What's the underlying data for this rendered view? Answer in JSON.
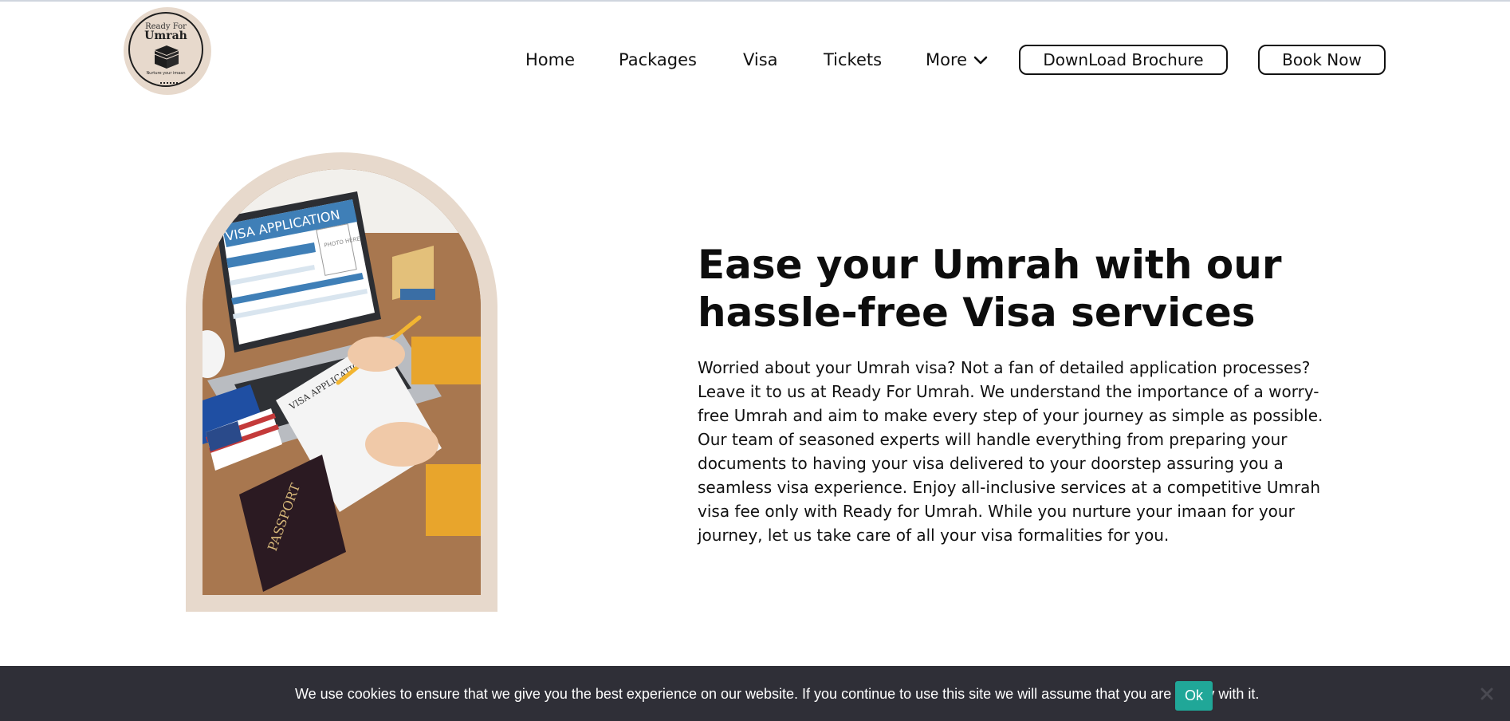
{
  "header": {
    "logo": {
      "top_text": "Ready For",
      "brand": "Umrah",
      "tagline": "Nurture your imaan"
    },
    "nav": [
      {
        "label": "Home"
      },
      {
        "label": "Packages"
      },
      {
        "label": "Visa"
      },
      {
        "label": "Tickets"
      },
      {
        "label": "More",
        "icon": "chevron-down-icon"
      }
    ],
    "buttons": {
      "brochure": "DownLoad Brochure",
      "book": "Book Now"
    }
  },
  "hero": {
    "image": {
      "laptop_title": "VISA APPLICATION",
      "photo_box": "PHOTO HERE",
      "paper_title": "VISA APPLICATION",
      "passport_text": "PASSPORT"
    },
    "heading_line1": "Ease your Umrah with our",
    "heading_line2": "hassle-free Visa services",
    "paragraph": "Worried about your Umrah visa? Not a fan of detailed application processes? Leave it to us at Ready For Umrah. We understand the importance of a worry-free Umrah and aim to make every step of your journey as simple as possible. Our team of seasoned experts will handle everything from preparing your documents to having your visa delivered to your doorstep assuring you a seamless visa experience. Enjoy all-inclusive services at a competitive Umrah visa fee only with Ready for Umrah. While you nurture your imaan for your journey, let us take care of all your visa formalities for you."
  },
  "cookie": {
    "message": "We use cookies to ensure that we give you the best experience on our website. If you continue to use this site we will assume that you are happy with it.",
    "ok_label": "Ok",
    "close_icon": "close-icon"
  },
  "colors": {
    "accent_beige": "#e7d9cc",
    "cookie_bar": "#2f2f37",
    "ok_button": "#20a798"
  }
}
